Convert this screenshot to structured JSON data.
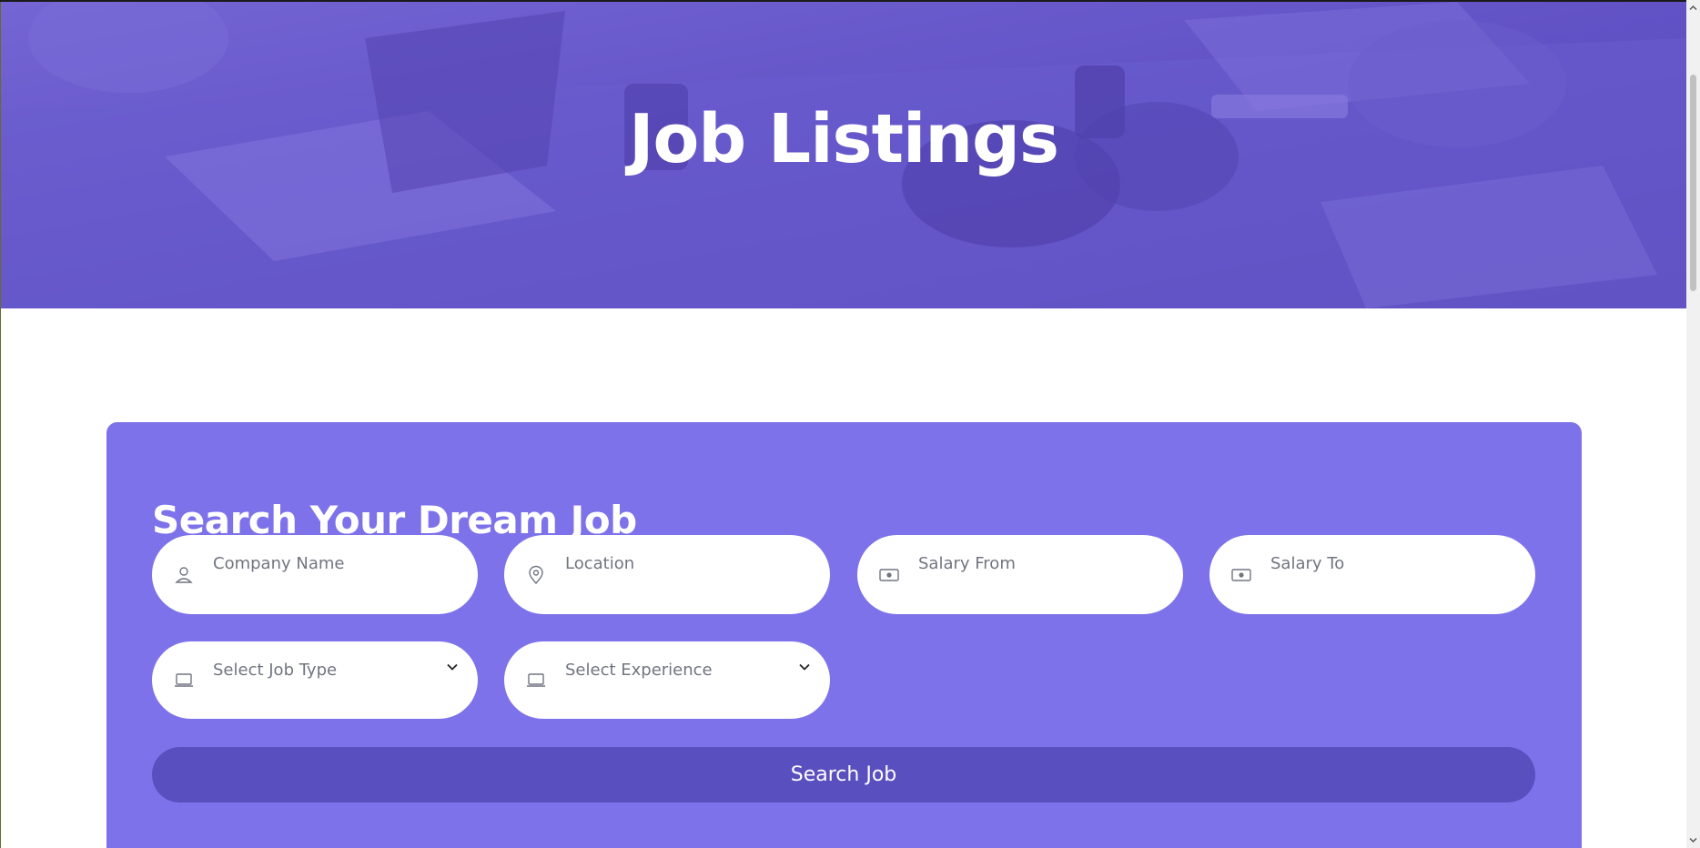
{
  "hero": {
    "title": "Job Listings"
  },
  "search": {
    "heading": "Search Your Dream Job",
    "fields": {
      "company": {
        "placeholder": "Company Name",
        "icon": "user-icon"
      },
      "location": {
        "placeholder": "Location",
        "icon": "map-pin-icon"
      },
      "salary_from": {
        "placeholder": "Salary From",
        "icon": "money-icon"
      },
      "salary_to": {
        "placeholder": "Salary To",
        "icon": "money-icon"
      },
      "job_type": {
        "selected": "Select Job Type",
        "icon": "laptop-icon"
      },
      "experience": {
        "selected": "Select Experience",
        "icon": "laptop-icon"
      }
    },
    "button_label": "Search Job"
  },
  "colors": {
    "panel": "#7d72ea",
    "button": "#5a4fbe",
    "hero_overlay": "#5e4fc4",
    "placeholder_text": "#707580"
  }
}
